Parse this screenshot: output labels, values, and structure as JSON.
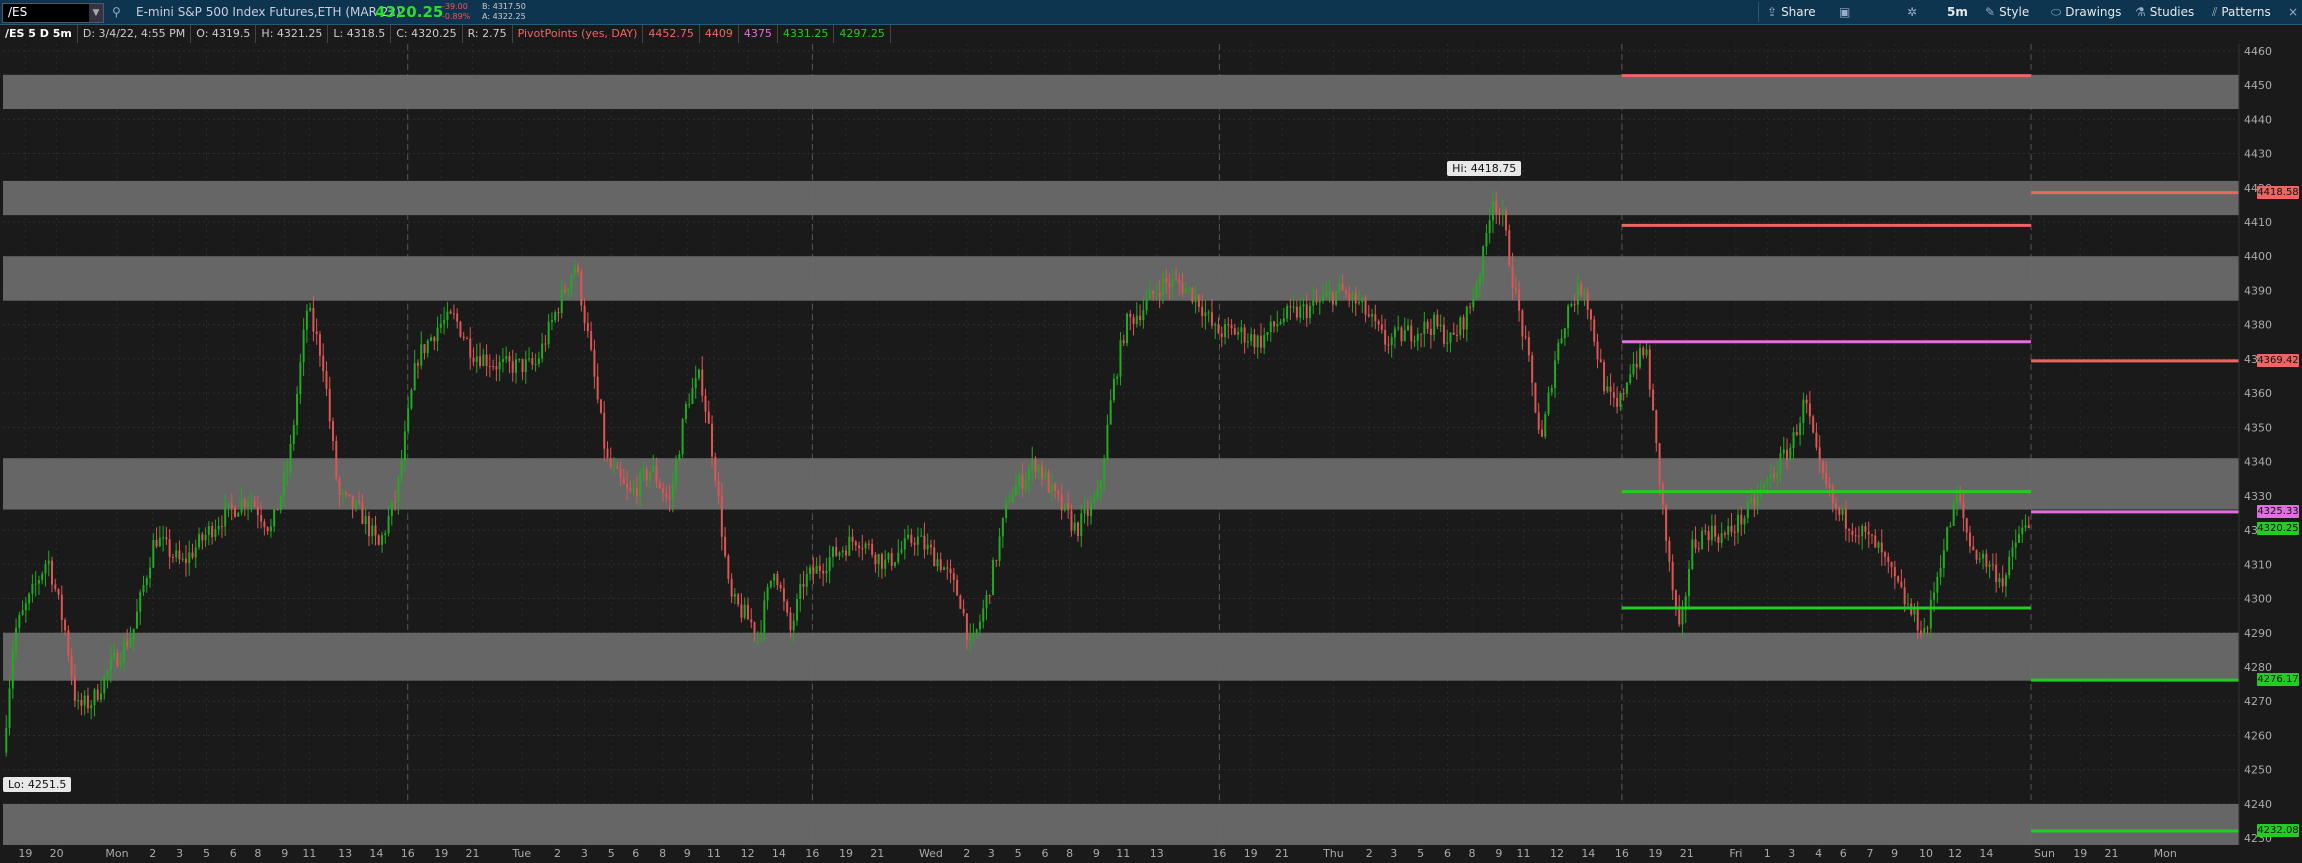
{
  "toolbar": {
    "symbol": "/ES",
    "instrument": "E-mini S&P 500 Index Futures,ETH (MAR 22)",
    "last_price": "4320.25",
    "change": "-39.00",
    "change_pct": "-0.89%",
    "bid": "B: 4317.50",
    "ask": "A: 4322.25",
    "share_label": "Share",
    "timeframe_label": "5m",
    "style_label": "Style",
    "drawings_label": "Drawings",
    "studies_label": "Studies",
    "patterns_label": "Patterns"
  },
  "info_bar": {
    "chart_name": "/ES 5 D 5m",
    "date": "D: 3/4/22, 4:55 PM",
    "open": "O: 4319.5",
    "high": "H: 4321.25",
    "low": "L: 4318.5",
    "close": "C: 4320.25",
    "range": "R: 2.75",
    "study_name": "PivotPoints (yes, DAY)",
    "pivot_values": [
      "4452.75",
      "4409",
      "4375",
      "4331.25",
      "4297.25"
    ]
  },
  "colors": {
    "resistance": "#f06464",
    "pivot": "#e070e0",
    "support": "#22cc22",
    "zone": "#6a6a6a",
    "candle_up": "#22aa22",
    "candle_down": "#dd5555"
  },
  "annotations": {
    "high": "Hi: 4418.75",
    "low": "Lo: 4251.5"
  },
  "chart_data": {
    "type": "candlestick",
    "y_range": [
      4228,
      4462
    ],
    "y_ticks": [
      4460,
      4450,
      4440,
      4430,
      4420,
      4410,
      4400,
      4390,
      4380,
      4370,
      4360,
      4350,
      4340,
      4330,
      4320,
      4310,
      4300,
      4290,
      4280,
      4270,
      4260,
      4250,
      4240,
      4230
    ],
    "x_labels": [
      {
        "label": "19",
        "pos": 0.01
      },
      {
        "label": "20",
        "pos": 0.024
      },
      {
        "label": "Mon",
        "pos": 0.051
      },
      {
        "label": "2",
        "pos": 0.067
      },
      {
        "label": "3",
        "pos": 0.079
      },
      {
        "label": "5",
        "pos": 0.091
      },
      {
        "label": "6",
        "pos": 0.103
      },
      {
        "label": "8",
        "pos": 0.114
      },
      {
        "label": "9",
        "pos": 0.126
      },
      {
        "label": "11",
        "pos": 0.137
      },
      {
        "label": "13",
        "pos": 0.153
      },
      {
        "label": "14",
        "pos": 0.167
      },
      {
        "label": "16",
        "pos": 0.181
      },
      {
        "label": "19",
        "pos": 0.196
      },
      {
        "label": "21",
        "pos": 0.21
      },
      {
        "label": "Tue",
        "pos": 0.232
      },
      {
        "label": "2",
        "pos": 0.248
      },
      {
        "label": "3",
        "pos": 0.26
      },
      {
        "label": "5",
        "pos": 0.272
      },
      {
        "label": "6",
        "pos": 0.283
      },
      {
        "label": "8",
        "pos": 0.295
      },
      {
        "label": "9",
        "pos": 0.306
      },
      {
        "label": "11",
        "pos": 0.318
      },
      {
        "label": "12",
        "pos": 0.333
      },
      {
        "label": "14",
        "pos": 0.347
      },
      {
        "label": "16",
        "pos": 0.362
      },
      {
        "label": "19",
        "pos": 0.377
      },
      {
        "label": "21",
        "pos": 0.391
      },
      {
        "label": "Wed",
        "pos": 0.415
      },
      {
        "label": "2",
        "pos": 0.431
      },
      {
        "label": "3",
        "pos": 0.442
      },
      {
        "label": "5",
        "pos": 0.454
      },
      {
        "label": "6",
        "pos": 0.466
      },
      {
        "label": "8",
        "pos": 0.477
      },
      {
        "label": "9",
        "pos": 0.489
      },
      {
        "label": "11",
        "pos": 0.501
      },
      {
        "label": "13",
        "pos": 0.516
      },
      {
        "label": "16",
        "pos": 0.544
      },
      {
        "label": "19",
        "pos": 0.558
      },
      {
        "label": "21",
        "pos": 0.572
      },
      {
        "label": "Thu",
        "pos": 0.595
      },
      {
        "label": "2",
        "pos": 0.611
      },
      {
        "label": "3",
        "pos": 0.622
      },
      {
        "label": "5",
        "pos": 0.634
      },
      {
        "label": "6",
        "pos": 0.646
      },
      {
        "label": "8",
        "pos": 0.657
      },
      {
        "label": "9",
        "pos": 0.669
      },
      {
        "label": "11",
        "pos": 0.68
      },
      {
        "label": "12",
        "pos": 0.695
      },
      {
        "label": "14",
        "pos": 0.709
      },
      {
        "label": "16",
        "pos": 0.724
      },
      {
        "label": "19",
        "pos": 0.739
      },
      {
        "label": "21",
        "pos": 0.753
      },
      {
        "label": "Fri",
        "pos": 0.775
      },
      {
        "label": "1",
        "pos": 0.789
      },
      {
        "label": "3",
        "pos": 0.8
      },
      {
        "label": "4",
        "pos": 0.812
      },
      {
        "label": "6",
        "pos": 0.823
      },
      {
        "label": "7",
        "pos": 0.835
      },
      {
        "label": "9",
        "pos": 0.846
      },
      {
        "label": "10",
        "pos": 0.86
      },
      {
        "label": "12",
        "pos": 0.873
      },
      {
        "label": "14",
        "pos": 0.887
      },
      {
        "label": "Sun",
        "pos": 0.913
      },
      {
        "label": "19",
        "pos": 0.929
      },
      {
        "label": "21",
        "pos": 0.943
      },
      {
        "label": "Mon",
        "pos": 0.967
      }
    ],
    "day_dividers": [
      0.181,
      0.362,
      0.544,
      0.724,
      0.907
    ],
    "gray_zones": [
      [
        4443,
        4453
      ],
      [
        4412,
        4422
      ],
      [
        4387,
        4400
      ],
      [
        4326,
        4341
      ],
      [
        4276,
        4290
      ],
      [
        4228,
        4240
      ]
    ],
    "pivot_segments": [
      {
        "name": "R2",
        "value": 4452.75,
        "from": 0.724,
        "to": 0.907,
        "kind": "resistance"
      },
      {
        "name": "R1",
        "value": 4409,
        "from": 0.724,
        "to": 0.907,
        "kind": "resistance"
      },
      {
        "name": "PP",
        "value": 4375,
        "from": 0.724,
        "to": 0.907,
        "kind": "pivot"
      },
      {
        "name": "S1",
        "value": 4331.25,
        "from": 0.724,
        "to": 0.907,
        "kind": "support"
      },
      {
        "name": "S2",
        "value": 4297.25,
        "from": 0.724,
        "to": 0.907,
        "kind": "support"
      },
      {
        "name": "R2n",
        "value": 4418.58,
        "from": 0.907,
        "to": 1.0,
        "kind": "resistance"
      },
      {
        "name": "R1n",
        "value": 4369.42,
        "from": 0.907,
        "to": 1.0,
        "kind": "resistance"
      },
      {
        "name": "PPn",
        "value": 4325.33,
        "from": 0.907,
        "to": 1.0,
        "kind": "pivot"
      },
      {
        "name": "S1n",
        "value": 4276.17,
        "from": 0.907,
        "to": 1.0,
        "kind": "support"
      },
      {
        "name": "S2n",
        "value": 4232.08,
        "from": 0.907,
        "to": 1.0,
        "kind": "support"
      }
    ],
    "price_tags": [
      {
        "value": 4418.58,
        "label": "4418.58",
        "kind": "resistance"
      },
      {
        "value": 4369.42,
        "label": "4369.42",
        "kind": "resistance"
      },
      {
        "value": 4325.33,
        "label": "4325.33",
        "kind": "pivot"
      },
      {
        "value": 4320.25,
        "label": "4320.25",
        "kind": "support"
      },
      {
        "value": 4276.17,
        "label": "4276.17",
        "kind": "support"
      },
      {
        "value": 4232.08,
        "label": "4232.08",
        "kind": "support"
      }
    ],
    "price_path": [
      [
        0.0,
        4255
      ],
      [
        0.005,
        4290
      ],
      [
        0.012,
        4300
      ],
      [
        0.02,
        4312
      ],
      [
        0.028,
        4290
      ],
      [
        0.033,
        4268
      ],
      [
        0.04,
        4270
      ],
      [
        0.048,
        4280
      ],
      [
        0.058,
        4290
      ],
      [
        0.068,
        4318
      ],
      [
        0.08,
        4310
      ],
      [
        0.095,
        4322
      ],
      [
        0.11,
        4330
      ],
      [
        0.12,
        4320
      ],
      [
        0.128,
        4340
      ],
      [
        0.136,
        4385
      ],
      [
        0.143,
        4370
      ],
      [
        0.15,
        4330
      ],
      [
        0.16,
        4325
      ],
      [
        0.168,
        4315
      ],
      [
        0.176,
        4330
      ],
      [
        0.185,
        4370
      ],
      [
        0.195,
        4380
      ],
      [
        0.202,
        4382
      ],
      [
        0.21,
        4372
      ],
      [
        0.222,
        4368
      ],
      [
        0.238,
        4368
      ],
      [
        0.248,
        4385
      ],
      [
        0.256,
        4398
      ],
      [
        0.262,
        4375
      ],
      [
        0.27,
        4340
      ],
      [
        0.28,
        4330
      ],
      [
        0.29,
        4338
      ],
      [
        0.298,
        4328
      ],
      [
        0.306,
        4358
      ],
      [
        0.312,
        4365
      ],
      [
        0.318,
        4340
      ],
      [
        0.325,
        4300
      ],
      [
        0.332,
        4295
      ],
      [
        0.338,
        4290
      ],
      [
        0.345,
        4310
      ],
      [
        0.352,
        4290
      ],
      [
        0.358,
        4305
      ],
      [
        0.37,
        4312
      ],
      [
        0.382,
        4318
      ],
      [
        0.395,
        4310
      ],
      [
        0.408,
        4318
      ],
      [
        0.42,
        4310
      ],
      [
        0.428,
        4300
      ],
      [
        0.433,
        4285
      ],
      [
        0.44,
        4300
      ],
      [
        0.45,
        4330
      ],
      [
        0.462,
        4340
      ],
      [
        0.47,
        4330
      ],
      [
        0.48,
        4320
      ],
      [
        0.49,
        4330
      ],
      [
        0.496,
        4360
      ],
      [
        0.502,
        4380
      ],
      [
        0.51,
        4385
      ],
      [
        0.518,
        4392
      ],
      [
        0.526,
        4392
      ],
      [
        0.534,
        4388
      ],
      [
        0.542,
        4378
      ],
      [
        0.552,
        4378
      ],
      [
        0.562,
        4375
      ],
      [
        0.572,
        4382
      ],
      [
        0.585,
        4385
      ],
      [
        0.598,
        4390
      ],
      [
        0.608,
        4385
      ],
      [
        0.618,
        4375
      ],
      [
        0.63,
        4378
      ],
      [
        0.64,
        4380
      ],
      [
        0.648,
        4375
      ],
      [
        0.656,
        4385
      ],
      [
        0.662,
        4400
      ],
      [
        0.666,
        4418
      ],
      [
        0.671,
        4410
      ],
      [
        0.676,
        4390
      ],
      [
        0.682,
        4370
      ],
      [
        0.688,
        4345
      ],
      [
        0.694,
        4370
      ],
      [
        0.7,
        4385
      ],
      [
        0.707,
        4392
      ],
      [
        0.712,
        4375
      ],
      [
        0.717,
        4360
      ],
      [
        0.722,
        4355
      ],
      [
        0.728,
        4368
      ],
      [
        0.735,
        4372
      ],
      [
        0.74,
        4340
      ],
      [
        0.745,
        4310
      ],
      [
        0.75,
        4288
      ],
      [
        0.755,
        4315
      ],
      [
        0.762,
        4320
      ],
      [
        0.77,
        4318
      ],
      [
        0.78,
        4325
      ],
      [
        0.79,
        4335
      ],
      [
        0.8,
        4345
      ],
      [
        0.806,
        4358
      ],
      [
        0.812,
        4338
      ],
      [
        0.82,
        4325
      ],
      [
        0.83,
        4320
      ],
      [
        0.838,
        4315
      ],
      [
        0.846,
        4305
      ],
      [
        0.854,
        4295
      ],
      [
        0.86,
        4290
      ],
      [
        0.866,
        4310
      ],
      [
        0.874,
        4330
      ],
      [
        0.88,
        4315
      ],
      [
        0.888,
        4310
      ],
      [
        0.895,
        4305
      ],
      [
        0.902,
        4320
      ],
      [
        0.906,
        4320
      ]
    ]
  }
}
